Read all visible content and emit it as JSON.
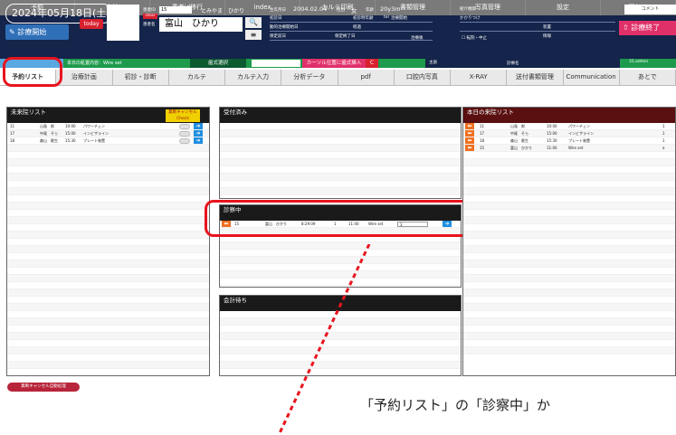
{
  "topnav": [
    "予約",
    "会計",
    "患者id移行",
    "index",
    "カルテ印刷",
    "書類管理",
    "写真管理",
    "設定",
    "閉じる"
  ],
  "header": {
    "date": "2024年05月18日(土)",
    "start_label": "診療開始",
    "today_label": "today",
    "patient_id_label": "患者ID",
    "patient_id": "15",
    "clear_label": "clear",
    "patient_name_label": "患者名",
    "kana": "とみやま　ひかり",
    "patient_name": "富山　ひかり",
    "birth_label": "生年月日",
    "birth_date": "2004.02.04",
    "sex_label": "性別",
    "sex": "女",
    "age_label": "年齢",
    "age": "20y3m",
    "first_visit_label": "初診日",
    "first_time_label": "初診時年齢",
    "tel_label": "tel",
    "tooth_label": "治療開始",
    "start_day_label": "動的治療開始日",
    "elapsed_label": "経過",
    "hold_label": "保定前日",
    "hold_end_label": "保定終了日",
    "ref_label": "紹介機関",
    "doctor_label": "かかりつけ",
    "retainer_label": "装置",
    "info_label": "情報",
    "status_label": "治療後",
    "stop_label": "転院・中止",
    "end_label": "診療終了",
    "comment_label": "コメント",
    "admin_label": "31.admin"
  },
  "greenbar": {
    "treatment": "本日の処置内容：Wire set",
    "tooth_select": "歯式選択",
    "cursor_insert": "カーソル位置に歯式挿入",
    "c_btn": "C",
    "doctor_label": "主訴",
    "dr_name_label": "診療名"
  },
  "tabs": [
    "予約リスト",
    "治療計画",
    "初診・診断",
    "カルテ",
    "カルテ入力",
    "分析データ",
    "pdf",
    "口腔内写真",
    "X-RAY",
    "送付書類管理",
    "Communication",
    "あとで"
  ],
  "future": {
    "title": "未来院リスト",
    "noshow_label": "無断キャンセル",
    "check_label": "Check",
    "headers": [
      "患者ID",
      "患者名",
      "予約時間",
      "処置内容"
    ],
    "rows": [
      {
        "id": "11",
        "name": "山島　郎",
        "time": "10:00",
        "proc": "パワーチェン"
      },
      {
        "id": "17",
        "name": "中尾　そら",
        "time": "15:00",
        "proc": "インビザライン"
      },
      {
        "id": "18",
        "name": "森山　歌生",
        "time": "15:30",
        "proc": "プレート装置"
      }
    ]
  },
  "reception": {
    "title": "受付済み",
    "headers": [
      "患者ID",
      "患者名",
      "来院時間",
      "unit",
      "予約時間",
      "処置内容"
    ]
  },
  "inexam": {
    "title": "診察中",
    "headers": [
      "患者ID",
      "患者名",
      "来院時間",
      "unit",
      "予約時間",
      "処置内容"
    ],
    "rows": [
      {
        "id": "15",
        "name": "富山　ひかり",
        "arrive": "8:29:09",
        "unit": "1",
        "time": "11:00",
        "proc": "Wire set",
        "sel": "3"
      }
    ]
  },
  "waiting": {
    "title": "会計待ち",
    "headers": [
      "患者ID",
      "患者名",
      "来院時間",
      "unit",
      "予約時間",
      "処置内容"
    ]
  },
  "today": {
    "title": "本日の来院リスト",
    "headers": [
      "患者ID",
      "患者名",
      "次回診療時間",
      "次回処置内容"
    ],
    "rows": [
      {
        "id": "11",
        "name": "山島　郎",
        "time": "10:00",
        "proc": "パワーチェン",
        "n": "1"
      },
      {
        "id": "17",
        "name": "中尾　そら",
        "time": "15:00",
        "proc": "インビザライン",
        "n": "1"
      },
      {
        "id": "18",
        "name": "森山　歌生",
        "time": "15:30",
        "proc": "プレート装置",
        "n": "1"
      },
      {
        "id": "15",
        "name": "富山　ひかり",
        "time": "11:00",
        "proc": "Wire set",
        "n": "a"
      }
    ]
  },
  "footer": {
    "noshow_auto": "無断キャンセル自動処理",
    "caption": "「予約リスト」の「診察中」か"
  },
  "colors": {
    "header_navy": "#14244a",
    "green_bar": "#1e9a4c",
    "annotation_red": "#e8141e",
    "future_title": "#1a1a1a",
    "today_title": "#5a1010"
  }
}
